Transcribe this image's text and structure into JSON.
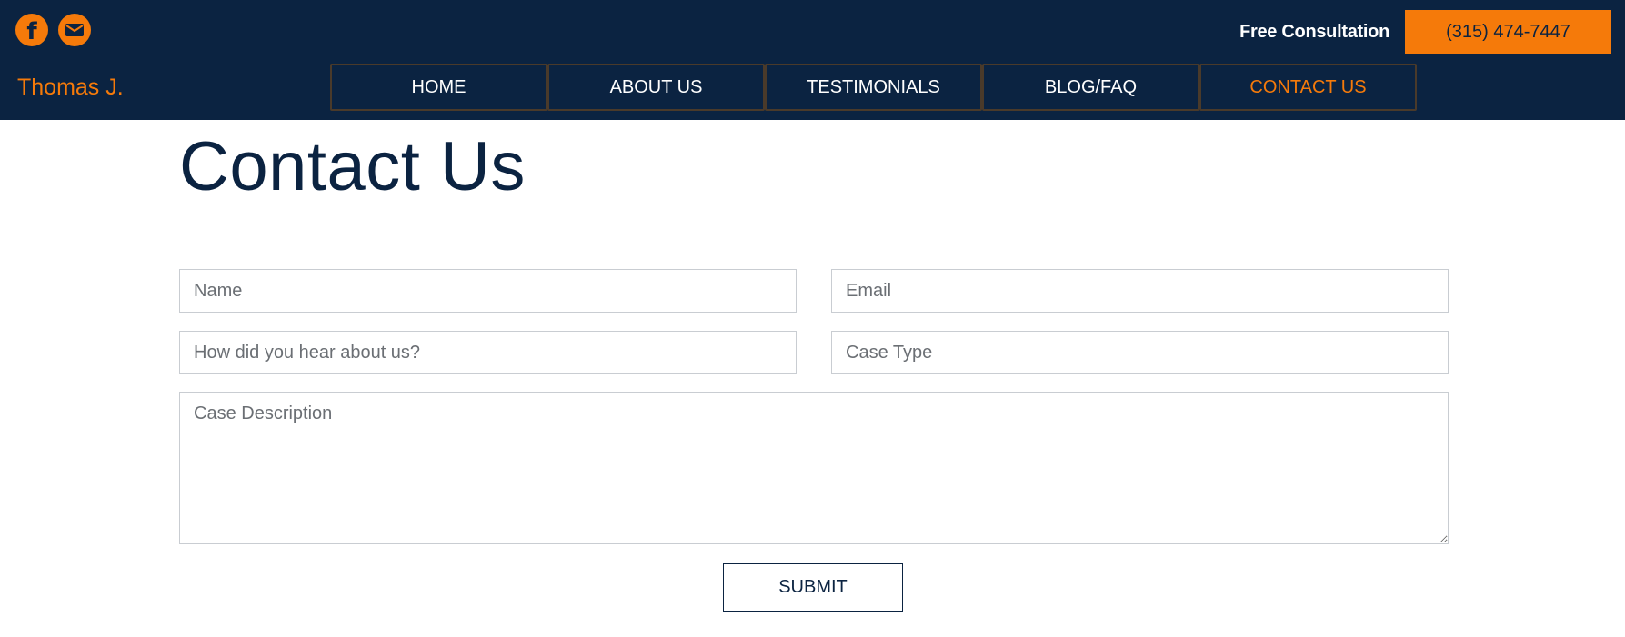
{
  "header": {
    "social": [
      {
        "icon": "facebook-icon"
      },
      {
        "icon": "envelope-icon"
      }
    ],
    "free_consultation": "Free Consultation",
    "phone": "(315) 474-7447",
    "brand": "Thomas J.",
    "nav": [
      {
        "label": "HOME",
        "active": false
      },
      {
        "label": "ABOUT US",
        "active": false
      },
      {
        "label": "TESTIMONIALS",
        "active": false
      },
      {
        "label": "BLOG/FAQ",
        "active": false
      },
      {
        "label": "CONTACT US",
        "active": true
      }
    ]
  },
  "main": {
    "title": "Contact Us",
    "form": {
      "name_placeholder": "Name",
      "email_placeholder": "Email",
      "referral_placeholder": "How did you hear about us?",
      "case_type_placeholder": "Case Type",
      "description_placeholder": "Case Description",
      "submit_label": "SUBMIT"
    }
  },
  "colors": {
    "navy": "#0b2341",
    "orange": "#f57a0a",
    "white": "#ffffff"
  }
}
